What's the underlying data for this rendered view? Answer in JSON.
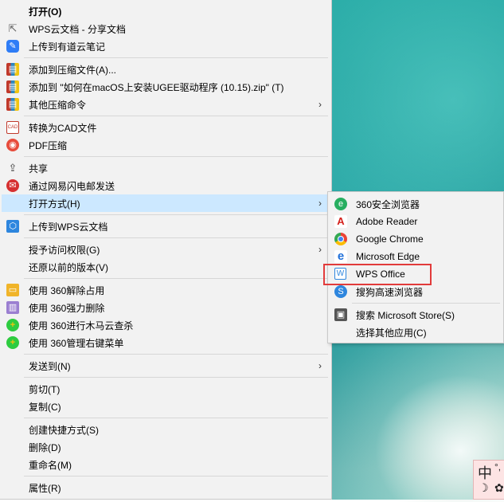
{
  "context_menu": {
    "items": [
      {
        "label": "打开(O)"
      },
      {
        "label": "WPS云文档 - 分享文档"
      },
      {
        "label": "上传到有道云笔记"
      },
      {
        "label": "添加到压缩文件(A)..."
      },
      {
        "label": "添加到 \"如何在macOS上安装UGEE驱动程序 (10.15).zip\" (T)"
      },
      {
        "label": "其他压缩命令"
      },
      {
        "label": "转换为CAD文件"
      },
      {
        "label": "PDF压缩"
      },
      {
        "label": "共享"
      },
      {
        "label": "通过网易闪电邮发送"
      },
      {
        "label": "打开方式(H)"
      },
      {
        "label": "上传到WPS云文档"
      },
      {
        "label": "授予访问权限(G)"
      },
      {
        "label": "还原以前的版本(V)"
      },
      {
        "label": "使用 360解除占用"
      },
      {
        "label": "使用 360强力删除"
      },
      {
        "label": "使用 360进行木马云查杀"
      },
      {
        "label": "使用 360管理右键菜单"
      },
      {
        "label": "发送到(N)"
      },
      {
        "label": "剪切(T)"
      },
      {
        "label": "复制(C)"
      },
      {
        "label": "创建快捷方式(S)"
      },
      {
        "label": "删除(D)"
      },
      {
        "label": "重命名(M)"
      },
      {
        "label": "属性(R)"
      }
    ],
    "cad_icon_text": "CAD",
    "arrow_glyph": "›"
  },
  "open_with_submenu": {
    "items": [
      {
        "label": "360安全浏览器"
      },
      {
        "label": "Adobe Reader"
      },
      {
        "label": "Google Chrome"
      },
      {
        "label": "Microsoft Edge"
      },
      {
        "label": "WPS Office"
      },
      {
        "label": "搜狗高速浏览器"
      },
      {
        "label": "搜索 Microsoft Store(S)"
      },
      {
        "label": "选择其他应用(C)"
      }
    ],
    "highlighted": "WPS Office",
    "highlight_color": "#e23b3b"
  },
  "ime_indicator": {
    "lang": "中",
    "punct": "°,",
    "moon": "☽",
    "gear": "✿"
  },
  "colors": {
    "menu_bg": "#f2f2f2",
    "hover_bg": "#cce8ff",
    "desktop_teal": "#0c8f8f"
  }
}
